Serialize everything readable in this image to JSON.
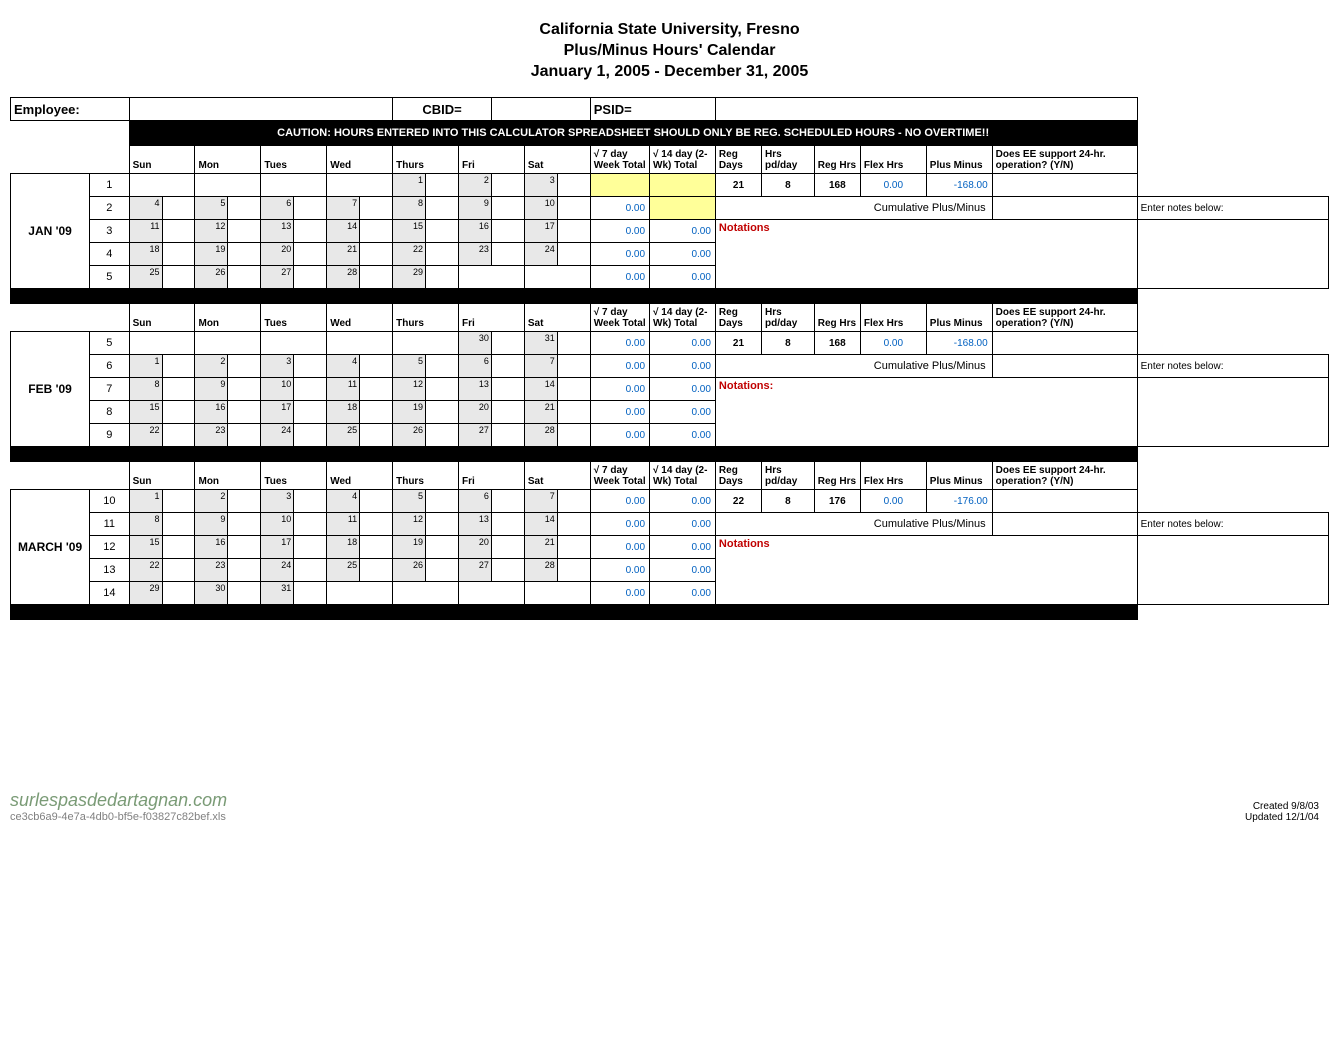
{
  "header": {
    "line1": "California State University, Fresno",
    "line2": "Plus/Minus Hours' Calendar",
    "line3": "January 1, 2005 - December 31, 2005"
  },
  "labels": {
    "employee": "Employee:",
    "cbid": "CBID=",
    "psid": "PSID=",
    "caution": "CAUTION:  HOURS ENTERED INTO THIS CALCULATOR SPREADSHEET SHOULD ONLY BE REG. SCHEDULED HOURS - NO OVERTIME!!",
    "days": [
      "Sun",
      "Mon",
      "Tues",
      "Wed",
      "Thurs",
      "Fri",
      "Sat"
    ],
    "c7": "√ 7 day Week Total",
    "c14": "√ 14 day (2-Wk) Total",
    "regDays": "Reg Days",
    "hrsPd": "Hrs pd/day",
    "regHrs": "Reg Hrs",
    "flexHrs": "Flex Hrs",
    "plusMinus": "Plus Minus",
    "eeSupport": "Does EE support 24-hr. operation? (Y/N)",
    "cumulative": "Cumulative Plus/Minus",
    "enterNotes": "Enter notes below:",
    "notations": "Notations",
    "notationsColon": "Notations:"
  },
  "months": [
    {
      "name": "JAN '09",
      "regDays": "21",
      "hrsPd": "8",
      "regHrs": "168",
      "flexHrs": "0.00",
      "plusMinus": "-168.00",
      "weeks": [
        {
          "n": "1",
          "dates": [
            "",
            "",
            "",
            "",
            "1",
            "2",
            "3"
          ],
          "wk": "",
          "wk14": ""
        },
        {
          "n": "2",
          "dates": [
            "4",
            "5",
            "6",
            "7",
            "8",
            "9",
            "10"
          ],
          "wk": "0.00",
          "wk14": ""
        },
        {
          "n": "3",
          "dates": [
            "11",
            "12",
            "13",
            "14",
            "15",
            "16",
            "17"
          ],
          "wk": "0.00",
          "wk14": "0.00"
        },
        {
          "n": "4",
          "dates": [
            "18",
            "19",
            "20",
            "21",
            "22",
            "23",
            "24"
          ],
          "wk": "0.00",
          "wk14": "0.00"
        },
        {
          "n": "5",
          "dates": [
            "25",
            "26",
            "27",
            "28",
            "29",
            "",
            ""
          ],
          "wk": "0.00",
          "wk14": "0.00"
        }
      ]
    },
    {
      "name": "FEB '09",
      "regDays": "21",
      "hrsPd": "8",
      "regHrs": "168",
      "flexHrs": "0.00",
      "plusMinus": "-168.00",
      "weeks": [
        {
          "n": "5",
          "dates": [
            "",
            "",
            "",
            "",
            "",
            "30",
            "31"
          ],
          "wk": "0.00",
          "wk14": "0.00"
        },
        {
          "n": "6",
          "dates": [
            "1",
            "2",
            "3",
            "4",
            "5",
            "6",
            "7"
          ],
          "wk": "0.00",
          "wk14": "0.00"
        },
        {
          "n": "7",
          "dates": [
            "8",
            "9",
            "10",
            "11",
            "12",
            "13",
            "14"
          ],
          "wk": "0.00",
          "wk14": "0.00"
        },
        {
          "n": "8",
          "dates": [
            "15",
            "16",
            "17",
            "18",
            "19",
            "20",
            "21"
          ],
          "wk": "0.00",
          "wk14": "0.00"
        },
        {
          "n": "9",
          "dates": [
            "22",
            "23",
            "24",
            "25",
            "26",
            "27",
            "28"
          ],
          "wk": "0.00",
          "wk14": "0.00"
        }
      ]
    },
    {
      "name": "MARCH '09",
      "regDays": "22",
      "hrsPd": "8",
      "regHrs": "176",
      "flexHrs": "0.00",
      "plusMinus": "-176.00",
      "weeks": [
        {
          "n": "10",
          "dates": [
            "1",
            "2",
            "3",
            "4",
            "5",
            "6",
            "7"
          ],
          "wk": "0.00",
          "wk14": "0.00"
        },
        {
          "n": "11",
          "dates": [
            "8",
            "9",
            "10",
            "11",
            "12",
            "13",
            "14"
          ],
          "wk": "0.00",
          "wk14": "0.00"
        },
        {
          "n": "12",
          "dates": [
            "15",
            "16",
            "17",
            "18",
            "19",
            "20",
            "21"
          ],
          "wk": "0.00",
          "wk14": "0.00"
        },
        {
          "n": "13",
          "dates": [
            "22",
            "23",
            "24",
            "25",
            "26",
            "27",
            "28"
          ],
          "wk": "0.00",
          "wk14": "0.00"
        },
        {
          "n": "14",
          "dates": [
            "29",
            "30",
            "31",
            "",
            "",
            "",
            ""
          ],
          "wk": "0.00",
          "wk14": "0.00"
        }
      ]
    }
  ],
  "footer": {
    "url": "surlespasdedartagnan.com",
    "id": "ce3cb6a9-4e7a-4db0-bf5e-f03827c82bef.xls",
    "created": "Created 9/8/03",
    "updated": "Updated 12/1/04"
  }
}
